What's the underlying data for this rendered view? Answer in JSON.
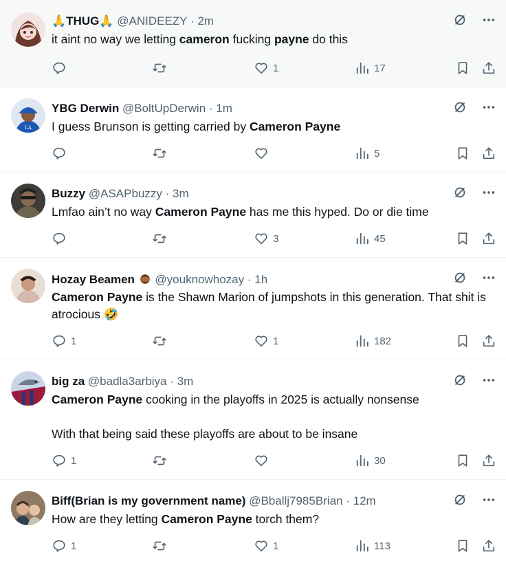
{
  "tweets": [
    {
      "name": "🙏THUG🙏",
      "handle": "@ANIDEEZY",
      "time": "· 2m",
      "segments": [
        {
          "t": "it aint no way we letting ",
          "b": false
        },
        {
          "t": "cameron",
          "b": true
        },
        {
          "t": " fucking ",
          "b": false
        },
        {
          "t": "payne",
          "b": true
        },
        {
          "t": " do this",
          "b": false
        }
      ],
      "counts": {
        "reply": "",
        "retweet": "",
        "like": "1",
        "views": "17"
      },
      "avatar_color": "#c9a7a0",
      "highlighted": true
    },
    {
      "name": "YBG Derwin",
      "handle": "@BoltUpDerwin",
      "time": "· 1m",
      "segments": [
        {
          "t": "I guess Brunson is getting carried by ",
          "b": false
        },
        {
          "t": "Cameron Payne",
          "b": true
        }
      ],
      "counts": {
        "reply": "",
        "retweet": "",
        "like": "",
        "views": "5"
      },
      "avatar_color": "#2a62b8",
      "highlighted": false
    },
    {
      "name": "Buzzy",
      "handle": "@ASAPbuzzy",
      "time": "· 3m",
      "segments": [
        {
          "t": "Lmfao ain’t no way ",
          "b": false
        },
        {
          "t": "Cameron Payne",
          "b": true
        },
        {
          "t": " has me this hyped. Do or die time",
          "b": false
        }
      ],
      "counts": {
        "reply": "",
        "retweet": "",
        "like": "3",
        "views": "45"
      },
      "avatar_color": "#4a4a44",
      "highlighted": false
    },
    {
      "name": "Hozay Beamen",
      "handle": "@youknowhozay",
      "time": "· 1h",
      "segments": [
        {
          "t": "Cameron Payne",
          "b": true
        },
        {
          "t": " is the Shawn Marion of jumpshots in this generation. That shit is atrocious 🤣",
          "b": false
        }
      ],
      "counts": {
        "reply": "1",
        "retweet": "",
        "like": "1",
        "views": "182"
      },
      "avatar_color": "#d8c4b8",
      "highlighted": false
    },
    {
      "name": "big za",
      "handle": "@badla3arbiya",
      "time": "· 3m",
      "segments": [
        {
          "t": "Cameron Payne",
          "b": true
        },
        {
          "t": " cooking in the playoffs in 2025 is actually nonsense\n\nWith that being said these playoffs are about to be insane",
          "b": false
        }
      ],
      "counts": {
        "reply": "1",
        "retweet": "",
        "like": "",
        "views": "30"
      },
      "avatar_color": "#3c4f7a",
      "highlighted": false
    },
    {
      "name": "Biff(Brian is my government name)",
      "handle": "@Bballj7985Brian",
      "time": "· 12m",
      "segments": [
        {
          "t": "How are they letting ",
          "b": false
        },
        {
          "t": "Cameron Payne",
          "b": true
        },
        {
          "t": " torch them?",
          "b": false
        }
      ],
      "counts": {
        "reply": "1",
        "retweet": "",
        "like": "1",
        "views": "113"
      },
      "avatar_color": "#6b5a4a",
      "highlighted": false
    }
  ],
  "colors": {
    "text": "#0f1419",
    "muted": "#536471",
    "divider": "#eff3f4",
    "highlight_bg": "#f7f9f9"
  }
}
